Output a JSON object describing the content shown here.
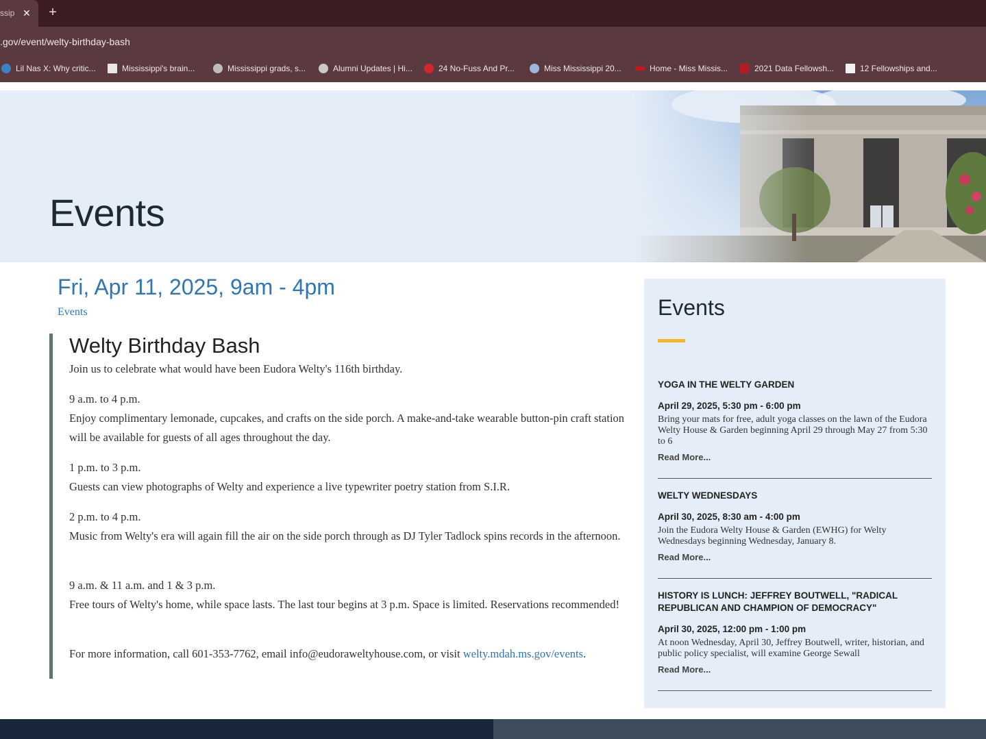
{
  "browser": {
    "tab": {
      "title": "ssip",
      "close_glyph": "✕"
    },
    "new_tab_glyph": "+",
    "url": ".gov/event/welty-birthday-bash",
    "bookmarks": [
      {
        "label": "Lil Nas X: Why critic...",
        "icon": "news-site-icon",
        "color": "#3b82c4"
      },
      {
        "label": "Mississippi's brain...",
        "icon": "newspaper-icon",
        "color": "#e8e8e8"
      },
      {
        "label": "Mississippi grads, s...",
        "icon": "globe-icon",
        "color": "#bdbdbd"
      },
      {
        "label": "Alumni Updates | Hi...",
        "icon": "seal-icon",
        "color": "#c9c9c9"
      },
      {
        "label": "24 No-Fuss And Pr...",
        "icon": "trending-icon",
        "color": "#d4262d"
      },
      {
        "label": "Miss Mississippi 20...",
        "icon": "crown-icon",
        "color": "#9bb7d9"
      },
      {
        "label": "Home - Miss Missis...",
        "icon": "red-banner-icon",
        "color": "#c8161d"
      },
      {
        "label": "2021 Data Fellowsh...",
        "icon": "chj-icon",
        "color": "#b01e23"
      },
      {
        "label": "12 Fellowships and...",
        "icon": "pf-icon",
        "color": "#f2f2f2"
      }
    ]
  },
  "hero": {
    "title": "Events"
  },
  "event": {
    "date": "Fri, Apr 11, 2025, 9am - 4pm",
    "category": "Events",
    "title": "Welty Birthday Bash",
    "intro": "Join us to celebrate what would have been Eudora Welty's 116th birthday.",
    "sections": [
      {
        "time": "9 a.m. to 4 p.m.",
        "text": "Enjoy complimentary lemonade, cupcakes, and crafts on the side porch. A make-and-take wearable button-pin craft station will be available for guests of all ages throughout the day."
      },
      {
        "time": "1 p.m. to 3 p.m.",
        "text": "Guests can view photographs of Welty and experience a live typewriter poetry station from S.I.R."
      },
      {
        "time": "2 p.m. to 4 p.m.",
        "text": "Music from Welty's era will again fill the air on the side porch through as DJ Tyler Tadlock spins records in the afternoon."
      },
      {
        "time": "9 a.m. & 11 a.m. and 1 & 3 p.m.",
        "text": "Free tours of Welty's home, while space lasts. The last tour begins at 3 p.m. Space is limited. Reservations recommended!"
      }
    ],
    "contact_text": "For more information, call 601-353-7762, email info@eudoraweltyhouse.com, or visit",
    "contact_link": "welty.mdah.ms.gov/events",
    "contact_end": "."
  },
  "sidebar": {
    "title": "Events",
    "items": [
      {
        "title": "Yoga in the Welty Garden",
        "date": "April 29, 2025, 5:30 pm - 6:00 pm",
        "desc": "Bring your mats for free, adult  yoga  classes on the lawn of the Eudora Welty House & Garden beginning April 29 through May 27 from 5:30 to 6",
        "more": "Read More..."
      },
      {
        "title": "Welty Wednesdays",
        "date": "April 30, 2025, 8:30 am - 4:00 pm",
        "desc": "Join the Eudora Welty House & Garden (EWHG) for Welty Wednesdays beginning Wednesday, January 8.",
        "more": "Read More..."
      },
      {
        "title": "History Is Lunch: Jeffrey Boutwell, \"Radical Republican and Champion of Democracy\"",
        "date": "April 30, 2025, 12:00 pm - 1:00 pm",
        "desc": "At noon Wednesday, April 30, Jeffrey Boutwell, writer, historian, and public policy specialist, will examine George Sewall",
        "more": "Read More..."
      }
    ]
  },
  "colors": {
    "link": "#2f76b6",
    "accent": "#f5b825",
    "hero_bg": "#e5eef8",
    "chrome": "#5a3a3f"
  }
}
